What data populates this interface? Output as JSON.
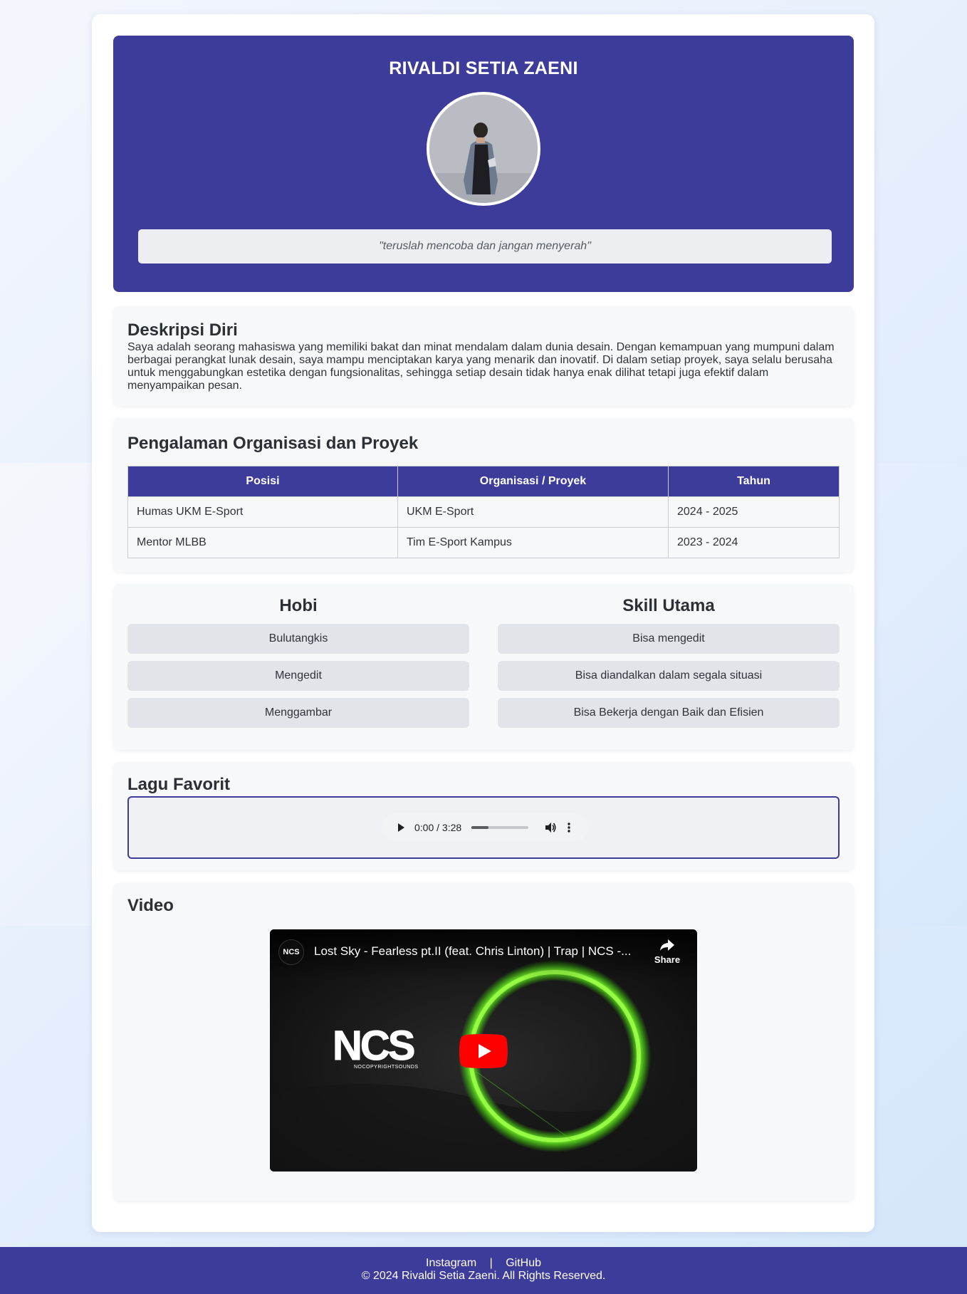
{
  "profile": {
    "name": "RIVALDI SETIA ZAENI",
    "quote": "\"teruslah mencoba dan jangan menyerah\""
  },
  "description": {
    "title": "Deskripsi Diri",
    "text": "Saya adalah seorang mahasiswa yang memiliki bakat dan minat mendalam dalam dunia desain. Dengan kemampuan yang mumpuni dalam berbagai perangkat lunak desain, saya mampu menciptakan karya yang menarik dan inovatif. Di dalam setiap proyek, saya selalu berusaha untuk menggabungkan estetika dengan fungsionalitas, sehingga setiap desain tidak hanya enak dilihat tetapi juga efektif dalam menyampaikan pesan."
  },
  "experience": {
    "title": "Pengalaman Organisasi dan Proyek",
    "headers": [
      "Posisi",
      "Organisasi / Proyek",
      "Tahun"
    ],
    "rows": [
      [
        "Humas UKM E-Sport",
        "UKM E-Sport",
        "2024 - 2025"
      ],
      [
        "Mentor MLBB",
        "Tim E-Sport Kampus",
        "2023 - 2024"
      ]
    ]
  },
  "hobbies": {
    "title": "Hobi",
    "items": [
      "Bulutangkis",
      "Mengedit",
      "Menggambar"
    ]
  },
  "skills": {
    "title": "Skill Utama",
    "items": [
      "Bisa mengedit",
      "Bisa diandalkan dalam segala situasi",
      "Bisa Bekerja dengan Baik dan Efisien"
    ]
  },
  "music": {
    "title": "Lagu Favorit",
    "time": "0:00 / 3:28",
    "progress": 0.3
  },
  "video": {
    "title": "Video",
    "video_title": "Lost Sky - Fearless pt.II (feat. Chris Linton) | Trap | NCS -...",
    "share_label": "Share",
    "channel_badge": "NCS",
    "logo_text": "NCS",
    "logo_subtext": "NOCOPYRIGHTSOUNDS"
  },
  "footer": {
    "instagram": "Instagram",
    "separator": "|",
    "github": "GitHub",
    "copyright": "© 2024 Rivaldi Setia Zaeni. All Rights Reserved."
  },
  "colors": {
    "primary": "#3d3c9a",
    "youtube_red": "#ff0000",
    "glow_green": "#7dff2a"
  },
  "icons": [
    "play-icon",
    "volume-icon",
    "more-options-icon",
    "share-icon",
    "youtube-play-icon"
  ]
}
